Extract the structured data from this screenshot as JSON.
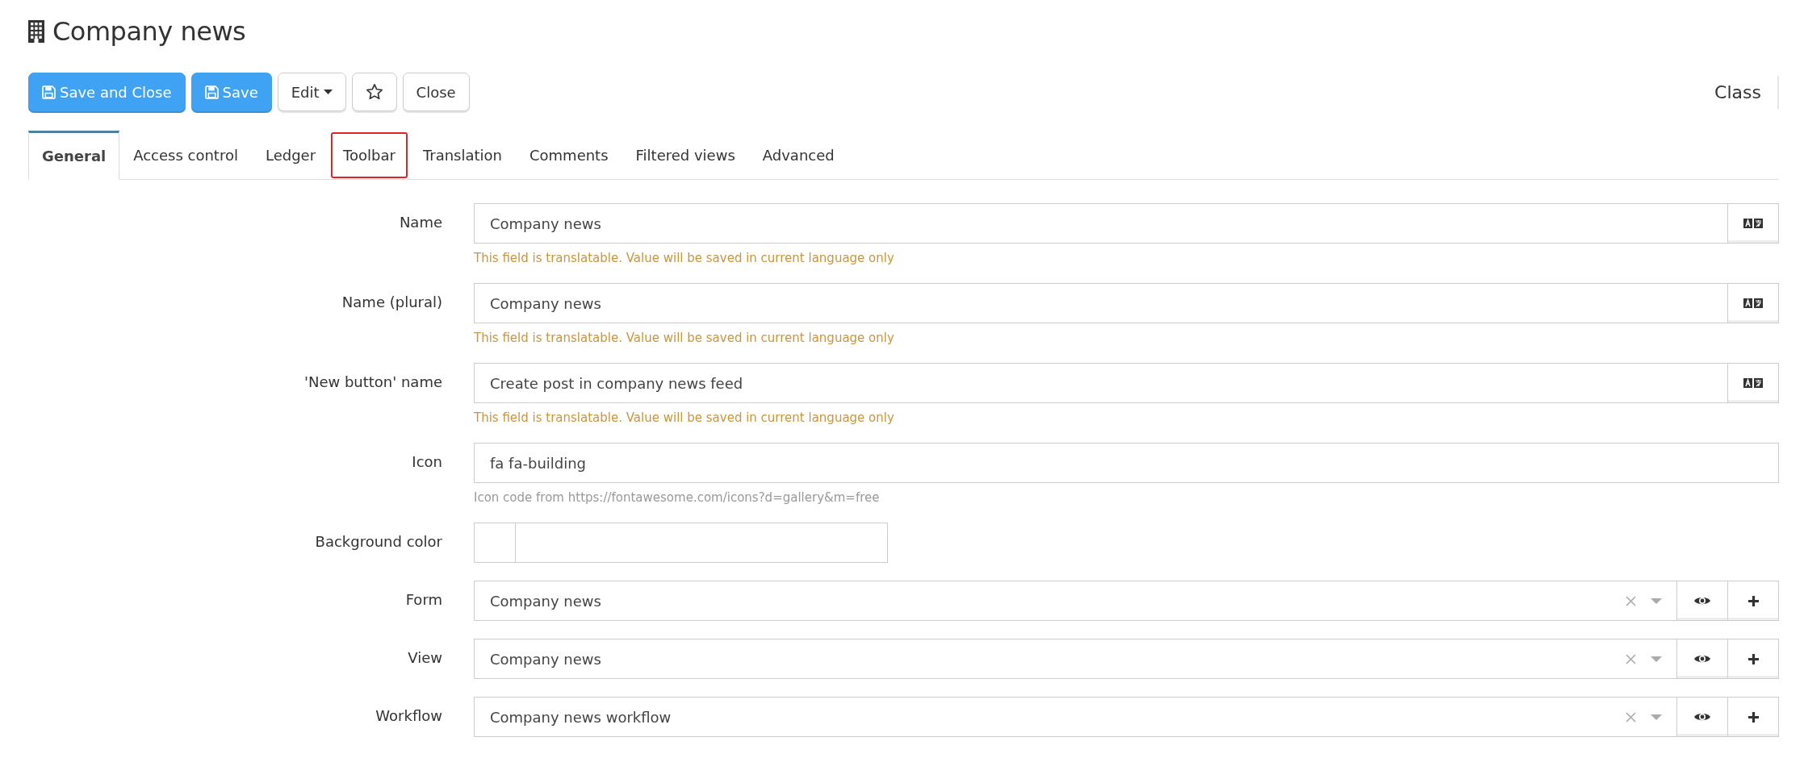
{
  "header": {
    "title": "Company news"
  },
  "toolbar": {
    "buttons": [
      {
        "label": "Save and Close",
        "kind": "primary"
      },
      {
        "label": "Save",
        "kind": "primary"
      },
      {
        "label": "Edit",
        "kind": "dropdown"
      },
      {
        "kind": "star"
      },
      {
        "label": "Close",
        "kind": "default"
      }
    ],
    "side_label": "Class"
  },
  "tabs": [
    {
      "label": "General",
      "selected": true,
      "highlighted": false
    },
    {
      "label": "Access control",
      "selected": false,
      "highlighted": false
    },
    {
      "label": "Ledger",
      "selected": false,
      "highlighted": false
    },
    {
      "label": "Toolbar",
      "selected": false,
      "highlighted": true
    },
    {
      "label": "Translation",
      "selected": false,
      "highlighted": false
    },
    {
      "label": "Comments",
      "selected": false,
      "highlighted": false
    },
    {
      "label": "Filtered views",
      "selected": false,
      "highlighted": false
    },
    {
      "label": "Advanced",
      "selected": false,
      "highlighted": false
    }
  ],
  "fields": [
    {
      "kind": "translatable",
      "label": "Name",
      "value": "Company news",
      "hint": "This field is translatable. Value will be saved in current language only"
    },
    {
      "kind": "translatable",
      "label": "Name (plural)",
      "value": "Company news",
      "hint": "This field is translatable. Value will be saved in current language only"
    },
    {
      "kind": "translatable",
      "label": "'New button' name",
      "value": "Create post in company news feed",
      "hint": "This field is translatable. Value will be saved in current language only"
    },
    {
      "kind": "text",
      "label": "Icon",
      "value": "fa fa-building",
      "hint": "Icon code from https://fontawesome.com/icons?d=gallery&m=free"
    },
    {
      "kind": "color",
      "label": "Background color"
    },
    {
      "kind": "select",
      "label": "Form",
      "value": "Company news"
    },
    {
      "kind": "select",
      "label": "View",
      "value": "Company news"
    },
    {
      "kind": "select",
      "label": "Workflow",
      "value": "Company news workflow"
    }
  ]
}
